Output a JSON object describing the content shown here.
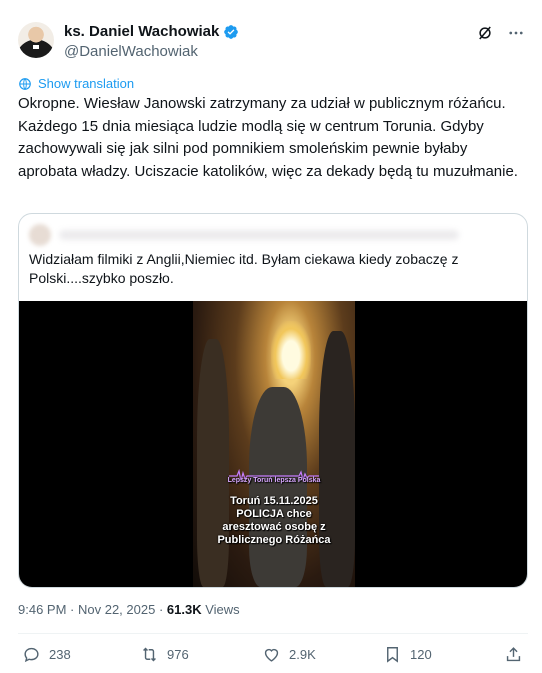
{
  "author": {
    "display_name": "ks. Daniel Wachowiak",
    "handle": "@DanielWachowiak",
    "verified": true
  },
  "icons": {
    "verified": "verified-badge-icon",
    "grok": "grok-icon",
    "more": "more-icon",
    "translate": "globe-icon"
  },
  "translate_label": "Show translation",
  "tweet_text": "Okropne. Wiesław Janowski zatrzymany za udział w publicznym różańcu. Każdego 15 dnia miesiąca ludzie modlą się w centrum Torunia. Gdyby zachowywali się jak silni pod pomnikiem smoleńskim pewnie byłaby aprobata władzy. Uciszacie katolików, więc za dekady będą tu muzułmanie.",
  "quote": {
    "text": "Widziałam filmiki z Anglii,Niemiec itd. Byłam ciekawa kiedy zobaczę z Polski....szybko poszło.",
    "video": {
      "watermark": "Lepszy Toruń lepsza Polska",
      "caption_lines": [
        "Toruń 15.11.2025",
        "POLICJA chce",
        "aresztować osobę z",
        "Publicznego Różańca"
      ]
    }
  },
  "meta": {
    "time": "9:46 PM",
    "separator": " · ",
    "date": "Nov 22, 2025",
    "views_count": "61.3K",
    "views_label": " Views"
  },
  "actions": {
    "replies": "238",
    "reposts": "976",
    "likes": "2.9K",
    "bookmarks": "120"
  },
  "colors": {
    "accent": "#1d9bf0",
    "text": "#0f1419",
    "secondary": "#536471",
    "border": "#cfd9de"
  }
}
